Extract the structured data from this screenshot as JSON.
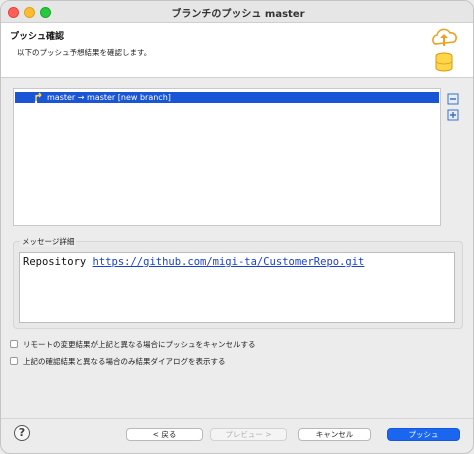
{
  "window": {
    "title": "ブランチのプッシュ master"
  },
  "banner": {
    "title": "プッシュ確認",
    "description": "以下のプッシュ予想結果を確認します。",
    "icon": "cloud-upload-database-icon"
  },
  "tree": {
    "rows": [
      {
        "icon": "push-branch-icon",
        "label": "master → master [new branch]",
        "selected": true
      }
    ]
  },
  "side_buttons": [
    {
      "icon": "collapse-all-icon"
    },
    {
      "icon": "expand-all-icon"
    }
  ],
  "message": {
    "group_label": "メッセージ詳細",
    "prefix": "Repository ",
    "link": "https://github.com/migi-ta/CustomerRepo.git"
  },
  "options": [
    {
      "label": "リモートの変更結果が上記と異なる場合にプッシュをキャンセルする",
      "checked": false
    },
    {
      "label": "上記の確認結果と異なる場合のみ結果ダイアログを表示する",
      "checked": false
    }
  ],
  "footer": {
    "help_label": "?",
    "back_label": "< 戻る",
    "preview_label": "プレビュー >",
    "cancel_label": "キャンセル",
    "push_label": "プッシュ"
  },
  "colors": {
    "accent": "#1a66f0",
    "selection": "#1a55d6",
    "link": "#1a3fd6"
  }
}
